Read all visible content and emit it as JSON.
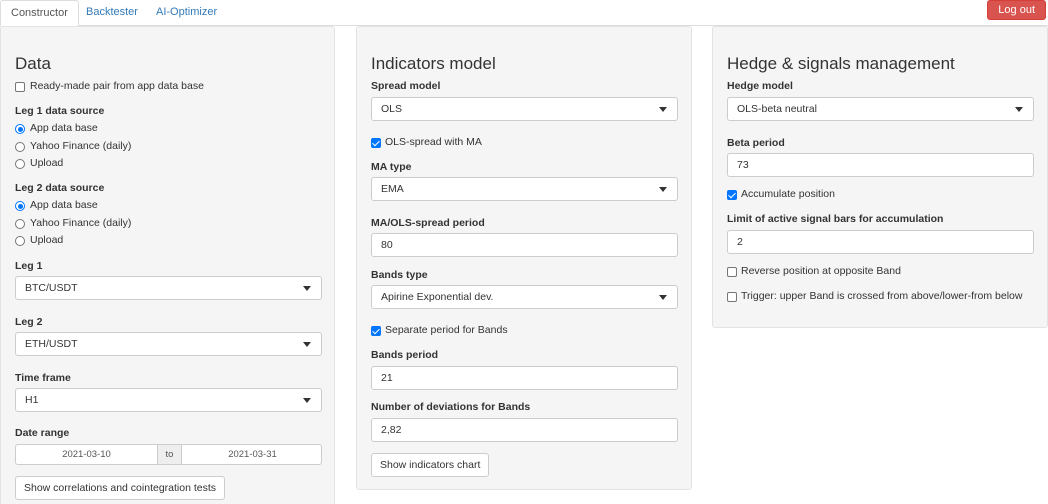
{
  "nav": {
    "tabs": [
      "Constructor",
      "Backtester",
      "AI-Optimizer"
    ],
    "active_tab": "Constructor",
    "logout_label": "Log out"
  },
  "colors": {
    "accent": "#337ab7",
    "danger": "#d9534f",
    "panel_bg": "#f5f5f5",
    "checkbox": "#0075ff"
  },
  "data_panel": {
    "title": "Data",
    "ready_made_label": "Ready-made pair from app data base",
    "ready_made_checked": false,
    "leg1_source_label": "Leg 1 data source",
    "leg1_options": [
      "App data base",
      "Yahoo Finance (daily)",
      "Upload"
    ],
    "leg1_selected": "App data base",
    "leg2_source_label": "Leg 2 data source",
    "leg2_options": [
      "App data base",
      "Yahoo Finance (daily)",
      "Upload"
    ],
    "leg2_selected": "App data base",
    "leg1_label": "Leg 1",
    "leg1_value": "BTC/USDT",
    "leg2_label": "Leg 2",
    "leg2_value": "ETH/USDT",
    "timeframe_label": "Time frame",
    "timeframe_value": "H1",
    "date_range_label": "Date range",
    "date_start": "2021-03-10",
    "date_sep": "to",
    "date_end": "2021-03-31",
    "correlations_button": "Show correlations and cointegration tests"
  },
  "indicators_panel": {
    "title": "Indicators model",
    "spread_model_label": "Spread model",
    "spread_model_value": "OLS",
    "ols_ma_label": "OLS-spread with MA",
    "ols_ma_checked": true,
    "ma_type_label": "MA type",
    "ma_type_value": "EMA",
    "ma_period_label": "MA/OLS-spread period",
    "ma_period_value": "80",
    "bands_type_label": "Bands type",
    "bands_type_value": "Apirine Exponential dev.",
    "separate_period_label": "Separate period for Bands",
    "separate_period_checked": true,
    "bands_period_label": "Bands period",
    "bands_period_value": "21",
    "num_dev_label": "Number of deviations for Bands",
    "num_dev_value": "2,82",
    "show_chart_button": "Show indicators chart"
  },
  "hedge_panel": {
    "title": "Hedge & signals management",
    "hedge_model_label": "Hedge model",
    "hedge_model_value": "OLS-beta neutral",
    "beta_period_label": "Beta period",
    "beta_period_value": "73",
    "accumulate_label": "Accumulate position",
    "accumulate_checked": true,
    "limit_label": "Limit of active signal bars for accumulation",
    "limit_value": "2",
    "reverse_label": "Reverse position at opposite Band",
    "reverse_checked": false,
    "trigger_label": "Trigger: upper Band is crossed from above/lower-from below",
    "trigger_checked": false
  }
}
